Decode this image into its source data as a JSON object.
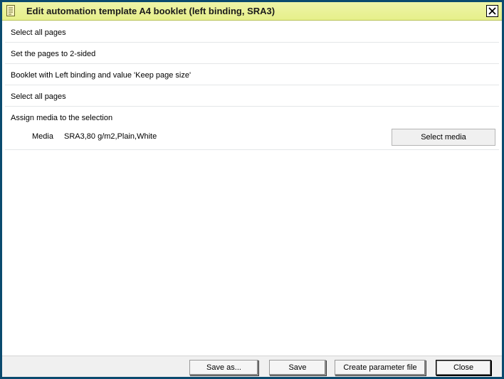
{
  "window": {
    "title": "Edit automation template A4 booklet (left binding, SRA3)",
    "title_icon": "document-icon",
    "close_icon": "close-icon"
  },
  "steps": [
    {
      "label": "Select all pages"
    },
    {
      "label": "Set the pages to 2-sided"
    },
    {
      "label": "Booklet with Left binding and value 'Keep page size'"
    },
    {
      "label": "Select all pages"
    },
    {
      "label": "Assign media to the selection"
    }
  ],
  "media": {
    "label": "Media",
    "value": "SRA3,80 g/m2,Plain,White",
    "button_label": "Select media"
  },
  "footer": {
    "save_as_label": "Save as...",
    "save_label": "Save",
    "create_parameter_file_label": "Create parameter file",
    "close_label": "Close"
  },
  "colors": {
    "window_border": "#0a4a6e",
    "titlebar": "#e6ef8a",
    "footer_bg": "#f0f0f0"
  }
}
